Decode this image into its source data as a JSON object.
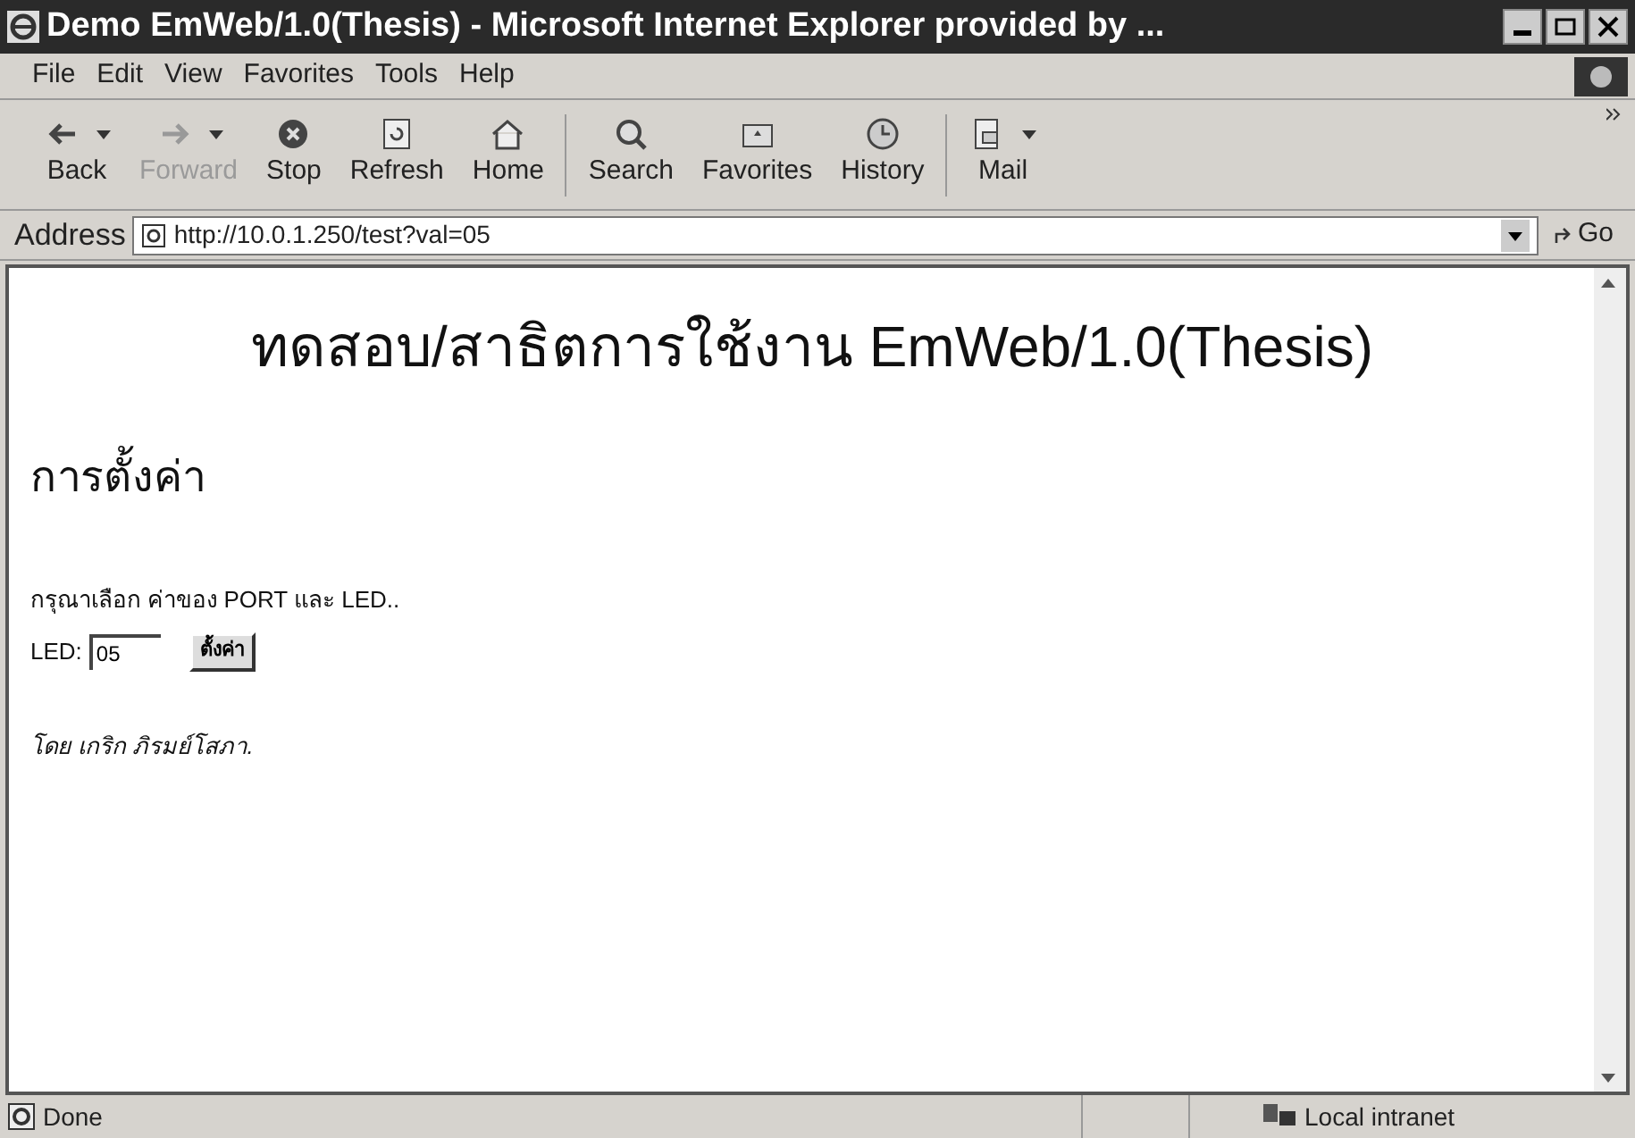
{
  "window": {
    "title": "Demo EmWeb/1.0(Thesis) - Microsoft Internet Explorer provided by ..."
  },
  "menu": [
    "File",
    "Edit",
    "View",
    "Favorites",
    "Tools",
    "Help"
  ],
  "toolbar": [
    {
      "label": "Back",
      "kind": "back",
      "disabled": false,
      "dropdown": true
    },
    {
      "label": "Forward",
      "kind": "forward",
      "disabled": true,
      "dropdown": true
    },
    {
      "label": "Stop",
      "kind": "stop",
      "disabled": false,
      "dropdown": false
    },
    {
      "label": "Refresh",
      "kind": "refresh",
      "disabled": false,
      "dropdown": false
    },
    {
      "label": "Home",
      "kind": "home",
      "disabled": false,
      "dropdown": false
    },
    {
      "label": "Search",
      "kind": "search",
      "disabled": false,
      "dropdown": false
    },
    {
      "label": "Favorites",
      "kind": "favorites",
      "disabled": false,
      "dropdown": false
    },
    {
      "label": "History",
      "kind": "history",
      "disabled": false,
      "dropdown": false
    },
    {
      "label": "Mail",
      "kind": "mail",
      "disabled": false,
      "dropdown": true
    }
  ],
  "address": {
    "label": "Address",
    "value": "http://10.0.1.250/test?val=05",
    "go": "Go"
  },
  "page": {
    "title": "ทดสอบ/สาธิตการใช้งาน EmWeb/1.0(Thesis)",
    "heading": "การตั้งค่า",
    "instruction": "กรุณาเลือก ค่าของ PORT และ LED..",
    "field_label": "LED:",
    "field_value": "05",
    "button": "ตั้งค่า",
    "footer": "โดย เกริก ภิรมย์โสภา."
  },
  "status_bar": {
    "text": "Done",
    "zone": "Local intranet"
  }
}
